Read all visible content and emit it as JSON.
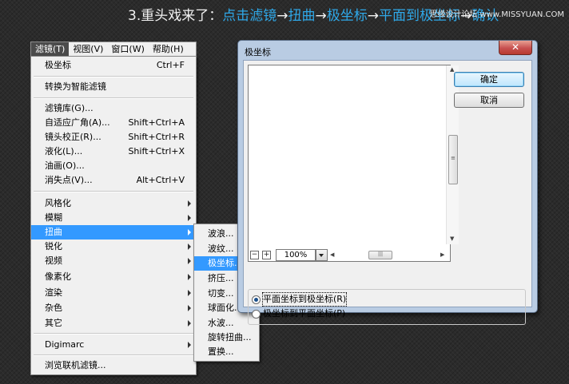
{
  "header": {
    "step": "3.重头戏来了：",
    "path": [
      "点击滤镜",
      "→",
      "扭曲",
      "→",
      "极坐标",
      "→",
      "平面到极坐标",
      "→",
      "确认"
    ],
    "watermark": "思缘设计论坛 www.MISSYUAN.COM"
  },
  "menubar": [
    "滤镜(T)",
    "视图(V)",
    "窗口(W)",
    "帮助(H)"
  ],
  "filter_menu": {
    "items": [
      {
        "label": "极坐标",
        "shortcut": "Ctrl+F"
      },
      {
        "label": "转换为智能滤镜"
      },
      {
        "label": "滤镜库(G)..."
      },
      {
        "label": "自适应广角(A)...",
        "shortcut": "Shift+Ctrl+A"
      },
      {
        "label": "镜头校正(R)...",
        "shortcut": "Shift+Ctrl+R"
      },
      {
        "label": "液化(L)...",
        "shortcut": "Shift+Ctrl+X"
      },
      {
        "label": "油画(O)..."
      },
      {
        "label": "消失点(V)...",
        "shortcut": "Alt+Ctrl+V"
      },
      {
        "label": "风格化"
      },
      {
        "label": "模糊"
      },
      {
        "label": "扭曲"
      },
      {
        "label": "锐化"
      },
      {
        "label": "视频"
      },
      {
        "label": "像素化"
      },
      {
        "label": "渲染"
      },
      {
        "label": "杂色"
      },
      {
        "label": "其它"
      },
      {
        "label": "Digimarc"
      },
      {
        "label": "浏览联机滤镜..."
      }
    ]
  },
  "distort_submenu": [
    "波浪...",
    "波纹...",
    "极坐标...",
    "挤压...",
    "切变...",
    "球面化...",
    "水波...",
    "旋转扭曲...",
    "置换..."
  ],
  "dialog": {
    "title": "极坐标",
    "close": "✕",
    "ok": "确定",
    "cancel": "取消",
    "zoom": "100%",
    "options": [
      "平面坐标到极坐标(R)",
      "极坐标到平面坐标(P)"
    ]
  }
}
